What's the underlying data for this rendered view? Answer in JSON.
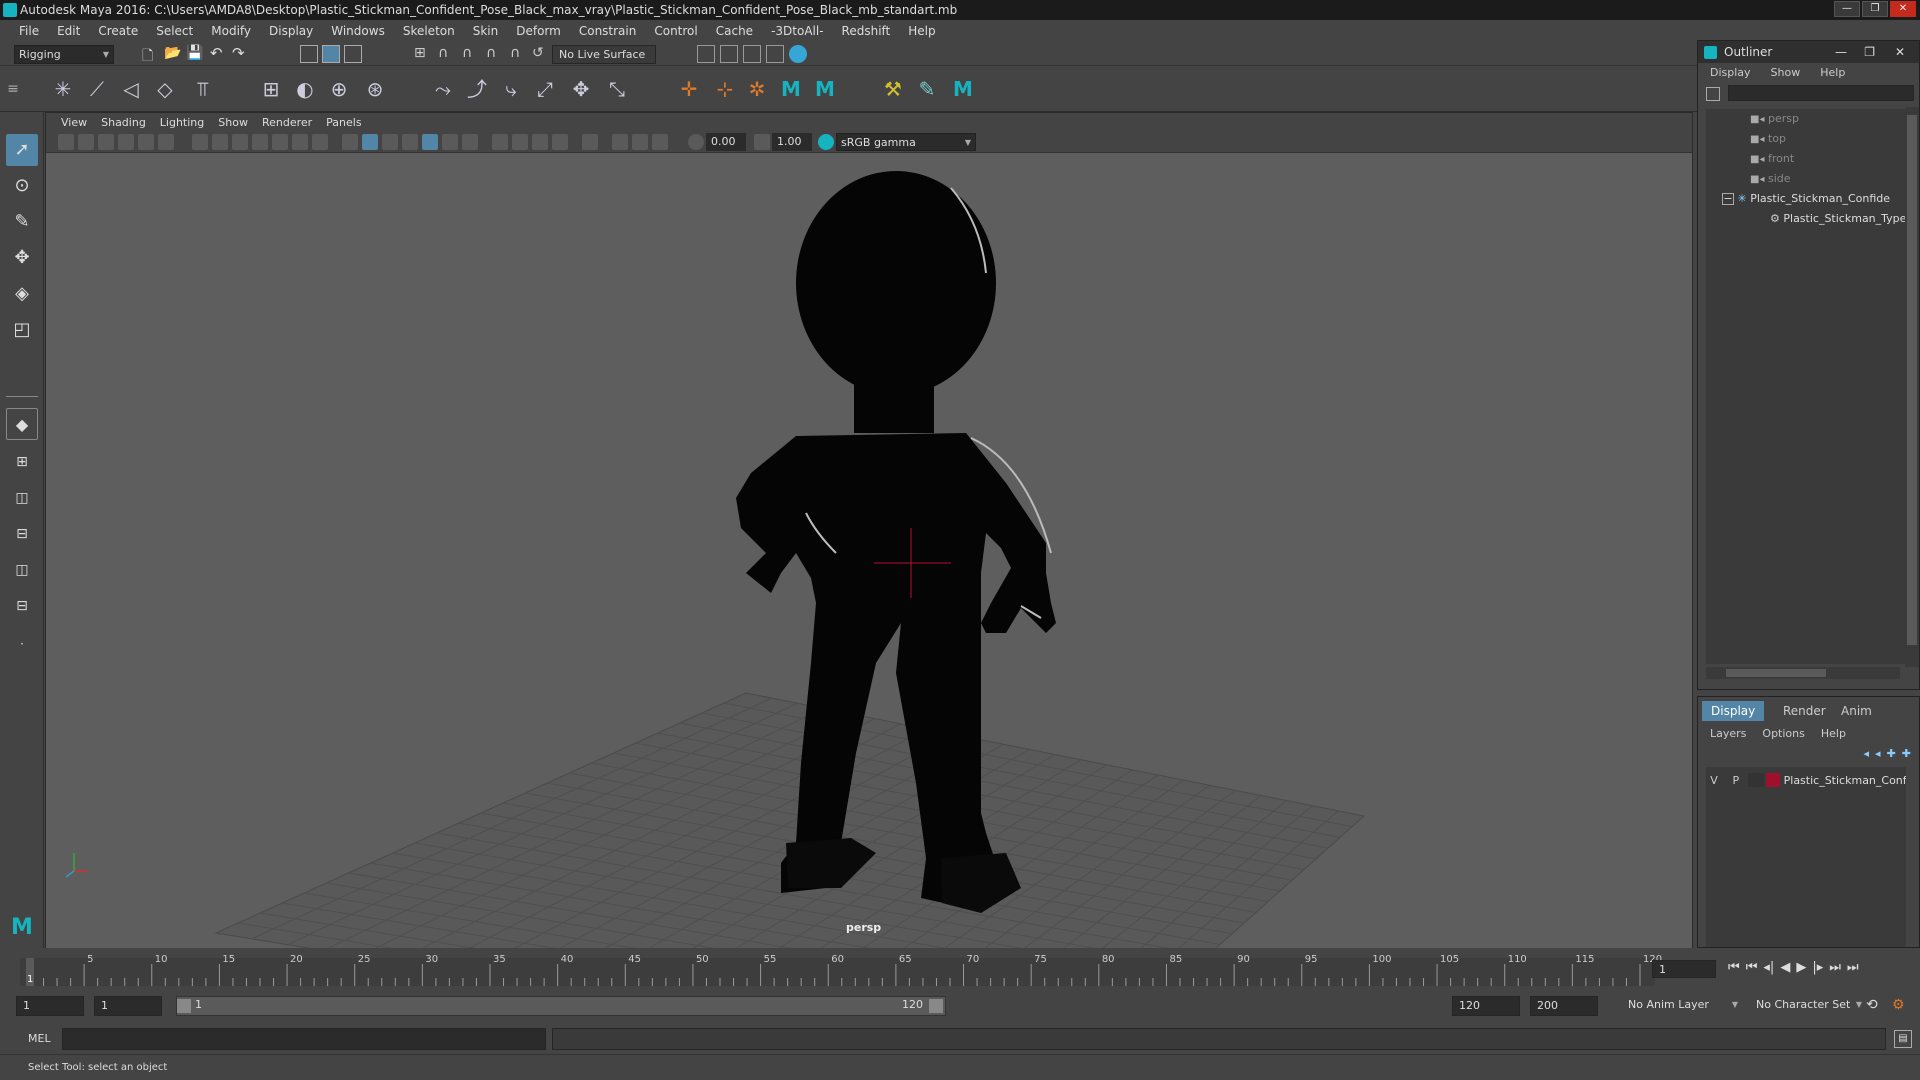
{
  "window": {
    "title": "Autodesk Maya 2016: C:\\Users\\AMDA8\\Desktop\\Plastic_Stickman_Confident_Pose_Black_max_vray\\Plastic_Stickman_Confident_Pose_Black_mb_standart.mb",
    "buttons": [
      "—",
      "❐",
      "✕"
    ]
  },
  "menubar": [
    "File",
    "Edit",
    "Create",
    "Select",
    "Modify",
    "Display",
    "Windows",
    "Skeleton",
    "Skin",
    "Deform",
    "Constrain",
    "Control",
    "Cache",
    "-3DtoAll-",
    "Redshift",
    "Help"
  ],
  "statusline": {
    "menuset": "Rigging",
    "live_surface": "No Live Surface"
  },
  "viewport": {
    "menu": [
      "View",
      "Shading",
      "Lighting",
      "Show",
      "Renderer",
      "Panels"
    ],
    "value1": "0.00",
    "value2": "1.00",
    "colorspace": "sRGB gamma",
    "camera_label": "persp"
  },
  "outliner": {
    "title": "Outliner",
    "menu": [
      "Display",
      "Show",
      "Help"
    ],
    "items": [
      {
        "label": "persp",
        "icon": "camera-icon"
      },
      {
        "label": "top",
        "icon": "camera-icon"
      },
      {
        "label": "front",
        "icon": "camera-icon"
      },
      {
        "label": "side",
        "icon": "camera-icon"
      },
      {
        "label": "Plastic_Stickman_Confide",
        "icon": "joint-icon",
        "expander": "−"
      },
      {
        "label": "Plastic_Stickman_Type",
        "icon": "mesh-icon"
      }
    ]
  },
  "layers": {
    "tabs": [
      "Display",
      "Render",
      "Anim"
    ],
    "menu": [
      "Layers",
      "Options",
      "Help"
    ],
    "row": {
      "v": "V",
      "p": "P",
      "name": "Plastic_Stickman_Conf",
      "color": "#a0102c"
    }
  },
  "timeline": {
    "ticks": [
      "5",
      "10",
      "15",
      "20",
      "25",
      "30",
      "35",
      "40",
      "45",
      "50",
      "55",
      "60",
      "65",
      "70",
      "75",
      "80",
      "85",
      "90",
      "95",
      "100",
      "105",
      "110",
      "115",
      "120"
    ],
    "start_marker": "1",
    "current_frame": "1"
  },
  "range": {
    "start": "1",
    "anim_start": "1",
    "slider_start": "1",
    "slider_end": "120",
    "end": "120",
    "anim_end": "200",
    "anim_layer": "No Anim Layer",
    "character_set": "No Character Set"
  },
  "command": {
    "label": "MEL",
    "help": "Select Tool: select an object"
  },
  "colors": {
    "accent": "#16b3c0",
    "layer_color": "#a0102c",
    "viewport_bg": "#5e5e5e",
    "shelf_orange": "#e07a28"
  }
}
